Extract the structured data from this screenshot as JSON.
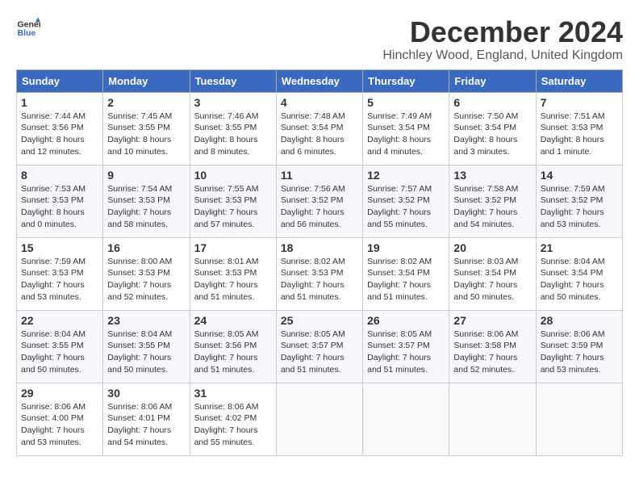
{
  "header": {
    "logo_line1": "General",
    "logo_line2": "Blue",
    "month_title": "December 2024",
    "location": "Hinchley Wood, England, United Kingdom"
  },
  "weekdays": [
    "Sunday",
    "Monday",
    "Tuesday",
    "Wednesday",
    "Thursday",
    "Friday",
    "Saturday"
  ],
  "weeks": [
    [
      {
        "day": "1",
        "sunrise": "Sunrise: 7:44 AM",
        "sunset": "Sunset: 3:56 PM",
        "daylight": "Daylight: 8 hours and 12 minutes."
      },
      {
        "day": "2",
        "sunrise": "Sunrise: 7:45 AM",
        "sunset": "Sunset: 3:55 PM",
        "daylight": "Daylight: 8 hours and 10 minutes."
      },
      {
        "day": "3",
        "sunrise": "Sunrise: 7:46 AM",
        "sunset": "Sunset: 3:55 PM",
        "daylight": "Daylight: 8 hours and 8 minutes."
      },
      {
        "day": "4",
        "sunrise": "Sunrise: 7:48 AM",
        "sunset": "Sunset: 3:54 PM",
        "daylight": "Daylight: 8 hours and 6 minutes."
      },
      {
        "day": "5",
        "sunrise": "Sunrise: 7:49 AM",
        "sunset": "Sunset: 3:54 PM",
        "daylight": "Daylight: 8 hours and 4 minutes."
      },
      {
        "day": "6",
        "sunrise": "Sunrise: 7:50 AM",
        "sunset": "Sunset: 3:54 PM",
        "daylight": "Daylight: 8 hours and 3 minutes."
      },
      {
        "day": "7",
        "sunrise": "Sunrise: 7:51 AM",
        "sunset": "Sunset: 3:53 PM",
        "daylight": "Daylight: 8 hours and 1 minute."
      }
    ],
    [
      {
        "day": "8",
        "sunrise": "Sunrise: 7:53 AM",
        "sunset": "Sunset: 3:53 PM",
        "daylight": "Daylight: 8 hours and 0 minutes."
      },
      {
        "day": "9",
        "sunrise": "Sunrise: 7:54 AM",
        "sunset": "Sunset: 3:53 PM",
        "daylight": "Daylight: 7 hours and 58 minutes."
      },
      {
        "day": "10",
        "sunrise": "Sunrise: 7:55 AM",
        "sunset": "Sunset: 3:53 PM",
        "daylight": "Daylight: 7 hours and 57 minutes."
      },
      {
        "day": "11",
        "sunrise": "Sunrise: 7:56 AM",
        "sunset": "Sunset: 3:52 PM",
        "daylight": "Daylight: 7 hours and 56 minutes."
      },
      {
        "day": "12",
        "sunrise": "Sunrise: 7:57 AM",
        "sunset": "Sunset: 3:52 PM",
        "daylight": "Daylight: 7 hours and 55 minutes."
      },
      {
        "day": "13",
        "sunrise": "Sunrise: 7:58 AM",
        "sunset": "Sunset: 3:52 PM",
        "daylight": "Daylight: 7 hours and 54 minutes."
      },
      {
        "day": "14",
        "sunrise": "Sunrise: 7:59 AM",
        "sunset": "Sunset: 3:52 PM",
        "daylight": "Daylight: 7 hours and 53 minutes."
      }
    ],
    [
      {
        "day": "15",
        "sunrise": "Sunrise: 7:59 AM",
        "sunset": "Sunset: 3:53 PM",
        "daylight": "Daylight: 7 hours and 53 minutes."
      },
      {
        "day": "16",
        "sunrise": "Sunrise: 8:00 AM",
        "sunset": "Sunset: 3:53 PM",
        "daylight": "Daylight: 7 hours and 52 minutes."
      },
      {
        "day": "17",
        "sunrise": "Sunrise: 8:01 AM",
        "sunset": "Sunset: 3:53 PM",
        "daylight": "Daylight: 7 hours and 51 minutes."
      },
      {
        "day": "18",
        "sunrise": "Sunrise: 8:02 AM",
        "sunset": "Sunset: 3:53 PM",
        "daylight": "Daylight: 7 hours and 51 minutes."
      },
      {
        "day": "19",
        "sunrise": "Sunrise: 8:02 AM",
        "sunset": "Sunset: 3:54 PM",
        "daylight": "Daylight: 7 hours and 51 minutes."
      },
      {
        "day": "20",
        "sunrise": "Sunrise: 8:03 AM",
        "sunset": "Sunset: 3:54 PM",
        "daylight": "Daylight: 7 hours and 50 minutes."
      },
      {
        "day": "21",
        "sunrise": "Sunrise: 8:04 AM",
        "sunset": "Sunset: 3:54 PM",
        "daylight": "Daylight: 7 hours and 50 minutes."
      }
    ],
    [
      {
        "day": "22",
        "sunrise": "Sunrise: 8:04 AM",
        "sunset": "Sunset: 3:55 PM",
        "daylight": "Daylight: 7 hours and 50 minutes."
      },
      {
        "day": "23",
        "sunrise": "Sunrise: 8:04 AM",
        "sunset": "Sunset: 3:55 PM",
        "daylight": "Daylight: 7 hours and 50 minutes."
      },
      {
        "day": "24",
        "sunrise": "Sunrise: 8:05 AM",
        "sunset": "Sunset: 3:56 PM",
        "daylight": "Daylight: 7 hours and 51 minutes."
      },
      {
        "day": "25",
        "sunrise": "Sunrise: 8:05 AM",
        "sunset": "Sunset: 3:57 PM",
        "daylight": "Daylight: 7 hours and 51 minutes."
      },
      {
        "day": "26",
        "sunrise": "Sunrise: 8:05 AM",
        "sunset": "Sunset: 3:57 PM",
        "daylight": "Daylight: 7 hours and 51 minutes."
      },
      {
        "day": "27",
        "sunrise": "Sunrise: 8:06 AM",
        "sunset": "Sunset: 3:58 PM",
        "daylight": "Daylight: 7 hours and 52 minutes."
      },
      {
        "day": "28",
        "sunrise": "Sunrise: 8:06 AM",
        "sunset": "Sunset: 3:59 PM",
        "daylight": "Daylight: 7 hours and 53 minutes."
      }
    ],
    [
      {
        "day": "29",
        "sunrise": "Sunrise: 8:06 AM",
        "sunset": "Sunset: 4:00 PM",
        "daylight": "Daylight: 7 hours and 53 minutes."
      },
      {
        "day": "30",
        "sunrise": "Sunrise: 8:06 AM",
        "sunset": "Sunset: 4:01 PM",
        "daylight": "Daylight: 7 hours and 54 minutes."
      },
      {
        "day": "31",
        "sunrise": "Sunrise: 8:06 AM",
        "sunset": "Sunset: 4:02 PM",
        "daylight": "Daylight: 7 hours and 55 minutes."
      },
      null,
      null,
      null,
      null
    ]
  ]
}
